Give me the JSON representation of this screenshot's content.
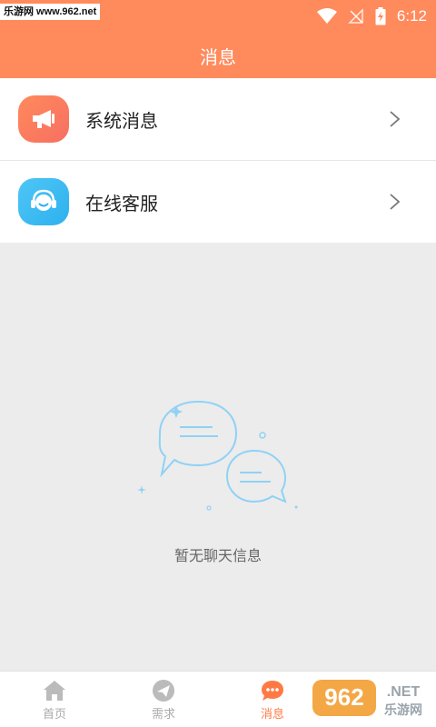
{
  "statusbar": {
    "watermark": "乐游网 www.962.net",
    "time": "6:12"
  },
  "header": {
    "title": "消息"
  },
  "menu": {
    "items": [
      {
        "label": "系统消息",
        "icon": "megaphone-icon"
      },
      {
        "label": "在线客服",
        "icon": "customer-service-icon"
      }
    ]
  },
  "empty_state": {
    "text": "暂无聊天信息"
  },
  "tabbar": {
    "tabs": [
      {
        "label": "首页",
        "icon": "home-icon",
        "active": false
      },
      {
        "label": "需求",
        "icon": "paper-plane-icon",
        "active": false
      },
      {
        "label": "消息",
        "icon": "chat-bubble-icon",
        "active": true
      }
    ]
  },
  "colors": {
    "accent": "#ff8a5c",
    "active_tab": "#ff7a45",
    "blue": "#2eb1ee",
    "background": "#ececec"
  },
  "brand_watermark": {
    "top": "962",
    "suffix": ".NET",
    "bottom": "乐游网"
  }
}
